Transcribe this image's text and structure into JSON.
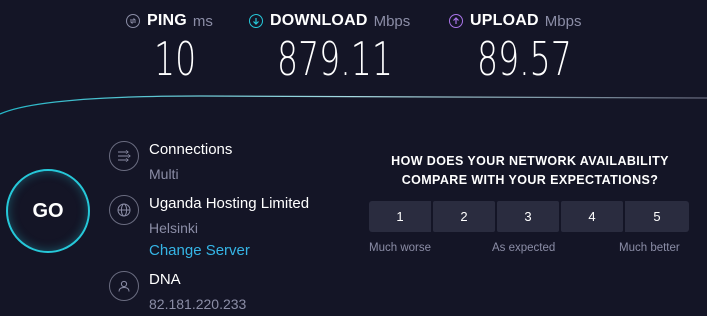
{
  "ping": {
    "label": "PING",
    "unit": "ms",
    "value": "10",
    "icon": "ping-icon"
  },
  "download": {
    "label": "DOWNLOAD",
    "unit": "Mbps",
    "value": "879.11",
    "icon": "download-arrow-icon"
  },
  "upload": {
    "label": "UPLOAD",
    "unit": "Mbps",
    "value": "89.57",
    "icon": "upload-arrow-icon"
  },
  "go_label": "GO",
  "connections": {
    "title": "Connections",
    "value": "Multi",
    "icon": "connections-icon"
  },
  "server": {
    "name": "Uganda Hosting Limited",
    "location": "Helsinki",
    "change_label": "Change Server",
    "icon": "globe-icon"
  },
  "isp": {
    "name": "DNA",
    "ip": "82.181.220.233",
    "icon": "user-icon"
  },
  "survey": {
    "question_line1": "HOW DOES YOUR NETWORK AVAILABILITY",
    "question_line2": "COMPARE WITH YOUR EXPECTATIONS?",
    "options": [
      "1",
      "2",
      "3",
      "4",
      "5"
    ],
    "label_low": "Much worse",
    "label_mid": "As expected",
    "label_high": "Much better"
  },
  "colors": {
    "background": "#141526",
    "accent_cyan": "#26c8d9",
    "ping_icon": "#8b8da6",
    "download_icon": "#26c8d9",
    "upload_icon": "#a974e8",
    "link": "#35b5e6",
    "muted_text": "#8b8da6"
  }
}
